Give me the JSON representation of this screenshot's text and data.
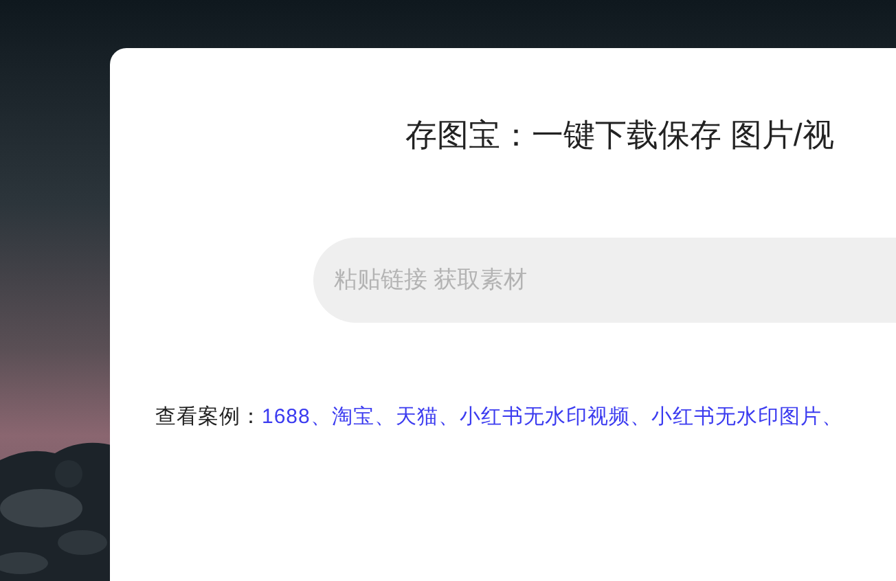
{
  "title": "存图宝：一键下载保存 图片/视",
  "search": {
    "placeholder": "粘贴链接 获取素材"
  },
  "examples": {
    "label": "查看案例：",
    "separator": "、",
    "links": [
      "1688",
      "淘宝",
      "天猫",
      "小红书无水印视频",
      "小红书无水印图片"
    ]
  }
}
